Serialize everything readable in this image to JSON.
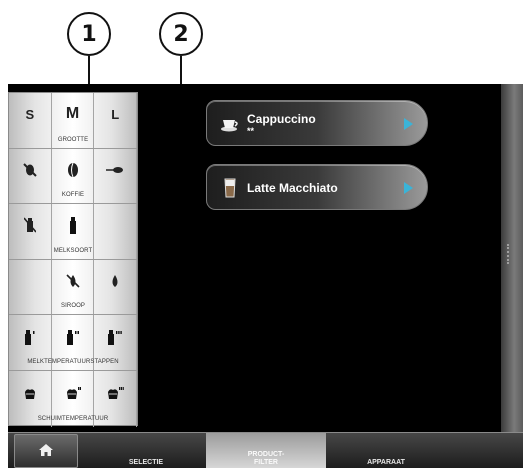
{
  "callouts": [
    "1",
    "2"
  ],
  "filter_panel": {
    "rows": [
      {
        "label": "GROOTTE",
        "cells": [
          "S",
          "M",
          "L"
        ]
      },
      {
        "label": "KOFFIE",
        "cells": [
          "no-coffee-icon",
          "coffee-bean-icon",
          "coffee-spoon-icon"
        ]
      },
      {
        "label": "MELKSOORT",
        "cells": [
          "no-milk-icon",
          "milk-bottle-icon",
          ""
        ]
      },
      {
        "label": "SIROOP",
        "cells": [
          "",
          "no-syrup-icon",
          "syrup-drop-icon"
        ]
      },
      {
        "label": "MELKTEMPERATUURSTAPPEN",
        "cells": [
          "milk-temp-1-icon",
          "milk-temp-2-icon",
          "milk-temp-3-icon"
        ]
      },
      {
        "label": "SCHUIMTEMPERATUUR",
        "cells": [
          "foam-temp-1-icon",
          "foam-temp-2-icon",
          "foam-temp-3-icon"
        ]
      }
    ]
  },
  "products": [
    {
      "name": "Cappuccino",
      "stars": "**",
      "icon": "cup-icon"
    },
    {
      "name": "Latte Macchiato",
      "stars": "",
      "icon": "glass-icon"
    }
  ],
  "nav": {
    "home_icon": "home-icon",
    "selectie": "SELECTIE",
    "filter_line1": "PRODUCT-",
    "filter_line2": "FILTER",
    "apparaat": "APPARAAT"
  }
}
